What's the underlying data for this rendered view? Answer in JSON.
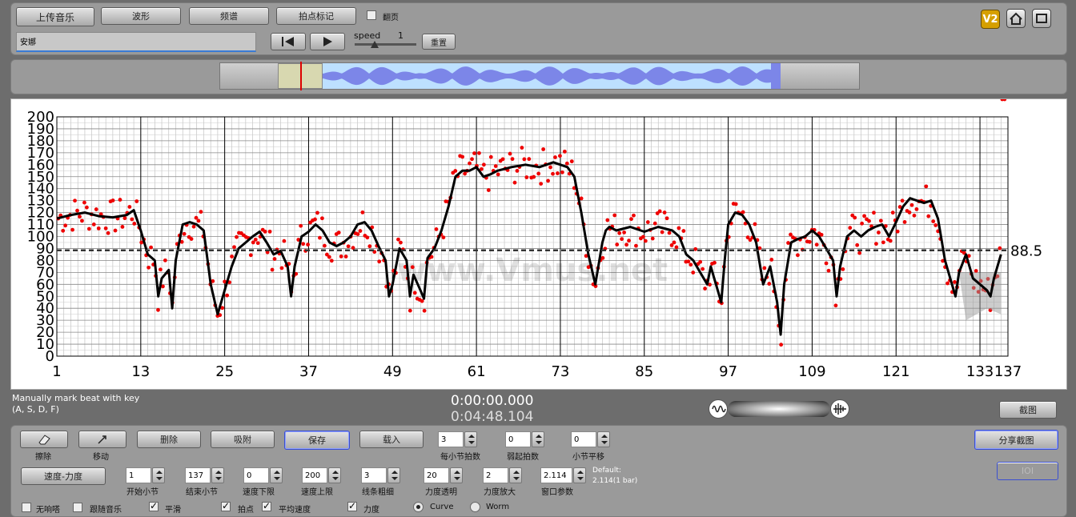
{
  "toolbar": {
    "upload": "上传音乐",
    "waveform": "波形",
    "spectrum": "频谱",
    "beat_mark": "拍点标记",
    "page_flip": "翻页",
    "v2": "V2"
  },
  "song": {
    "title": "安娜"
  },
  "playback": {
    "speed_label": "speed",
    "speed_value": "1",
    "reset": "重置"
  },
  "chart_data": {
    "type": "scatter",
    "x_ticks": [
      "1",
      "13",
      "25",
      "37",
      "49",
      "61",
      "73",
      "85",
      "97",
      "109",
      "121",
      "133",
      "137"
    ],
    "y_ticks": [
      "200",
      "190",
      "180",
      "170",
      "160",
      "150",
      "140",
      "130",
      "120",
      "110",
      "100",
      "90",
      "80",
      "70",
      "60",
      "50",
      "40",
      "30",
      "20",
      "10",
      "0"
    ],
    "xlim": [
      1,
      137
    ],
    "ylim": [
      0,
      200
    ],
    "avg_value": 88.5,
    "avg_label": "88.5",
    "watermark": "www.Vmus.net",
    "curve_x": [
      1,
      3,
      5,
      7,
      9,
      11,
      12,
      13,
      14,
      15,
      15.5,
      16,
      17,
      17.5,
      18,
      19,
      20,
      21,
      22,
      23,
      24,
      25,
      26,
      27,
      28,
      29,
      30,
      31,
      32,
      33,
      34,
      34.5,
      35,
      36,
      37,
      38,
      39,
      40,
      41,
      42,
      43,
      44,
      45,
      46,
      47,
      48,
      48.5,
      49,
      50,
      51,
      51.5,
      52,
      53,
      53.5,
      54,
      55,
      56,
      57,
      58,
      59,
      60,
      61,
      62,
      63,
      64,
      66,
      68,
      70,
      72,
      74,
      75,
      76,
      77,
      78,
      79,
      79.5,
      80,
      81,
      83,
      85,
      87,
      89,
      90,
      91,
      92,
      93,
      94,
      94.5,
      95,
      96,
      96.5,
      97,
      98,
      99,
      100,
      101,
      102,
      103,
      104,
      104.5,
      105,
      106,
      107,
      108,
      109,
      110,
      111,
      112,
      112.5,
      113,
      114,
      115,
      116,
      117,
      118,
      119,
      120,
      121,
      122,
      123,
      124,
      125,
      126,
      127,
      128,
      129,
      129.5,
      130,
      131,
      132,
      133,
      134,
      134.5,
      135,
      136,
      137
    ],
    "curve_y": [
      115,
      118,
      120,
      117,
      116,
      118,
      122,
      105,
      85,
      80,
      50,
      65,
      72,
      40,
      80,
      110,
      112,
      110,
      105,
      60,
      35,
      55,
      75,
      90,
      95,
      100,
      104,
      95,
      85,
      88,
      75,
      50,
      75,
      100,
      104,
      110,
      105,
      95,
      92,
      95,
      100,
      110,
      112,
      105,
      92,
      80,
      50,
      60,
      90,
      80,
      50,
      68,
      55,
      48,
      82,
      90,
      105,
      125,
      150,
      155,
      155,
      158,
      150,
      152,
      155,
      158,
      160,
      158,
      162,
      158,
      150,
      120,
      85,
      60,
      95,
      105,
      108,
      105,
      108,
      104,
      108,
      105,
      100,
      85,
      80,
      70,
      60,
      75,
      65,
      45,
      80,
      110,
      120,
      118,
      110,
      95,
      60,
      75,
      45,
      18,
      60,
      95,
      98,
      100,
      105,
      100,
      90,
      80,
      50,
      75,
      100,
      105,
      100,
      105,
      108,
      110,
      100,
      112,
      125,
      132,
      130,
      128,
      130,
      115,
      80,
      60,
      50,
      70,
      85,
      65,
      60,
      55,
      50,
      65,
      85
    ]
  },
  "time": {
    "current": "0:00:00.000",
    "total": "0:04:48.104"
  },
  "hint": {
    "line1": "Manually mark beat with key",
    "line2": "(A, S, D, F)"
  },
  "screenshot_btn": "截图",
  "share_btn": "分享截图",
  "ioi_btn": "IOI",
  "controls": {
    "erase": "擦除",
    "move": "移动",
    "delete": "删除",
    "snap": "吸附",
    "save": "保存",
    "load": "载入",
    "beats_per_bar": {
      "value": "3",
      "label": "每小节拍数"
    },
    "pickup": {
      "value": "0",
      "label": "弱起拍数"
    },
    "bar_shift": {
      "value": "0",
      "label": "小节平移"
    },
    "tempo_dynamics": "速度-力度",
    "start_bar": {
      "value": "1",
      "label": "开始小节"
    },
    "end_bar": {
      "value": "137",
      "label": "结束小节"
    },
    "tempo_low": {
      "value": "0",
      "label": "速度下限"
    },
    "tempo_high": {
      "value": "200",
      "label": "速度上限"
    },
    "line_width": {
      "value": "3",
      "label": "线条粗细"
    },
    "dyn_transparency": {
      "value": "20",
      "label": "力度透明"
    },
    "dyn_zoom": {
      "value": "2",
      "label": "力度放大"
    },
    "window_param": {
      "value": "2.114",
      "label": "窗口参数"
    },
    "default_note": "Default:",
    "default_value": "2.114(1 bar)"
  },
  "checks": {
    "no_metronome": "无响嗒",
    "follow_music": "跟随音乐",
    "smooth": "平滑",
    "beats": "拍点",
    "avg_tempo": "平均速度",
    "dynamics": "力度",
    "curve": "Curve",
    "worm": "Worm"
  }
}
